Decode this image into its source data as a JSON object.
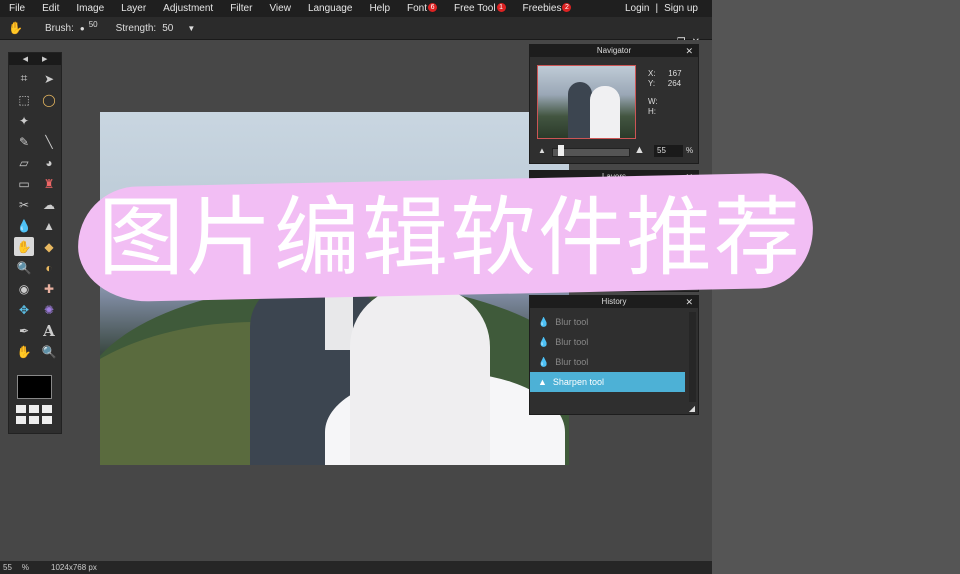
{
  "menu": {
    "items": [
      "File",
      "Edit",
      "Image",
      "Layer",
      "Adjustment",
      "Filter",
      "View",
      "Language",
      "Help"
    ],
    "font": {
      "label": "Font",
      "badge": "6"
    },
    "free_tool": {
      "label": "Free Tool",
      "badge": "1"
    },
    "freebies": {
      "label": "Freebies",
      "badge": "2"
    },
    "login": "Login",
    "separator": "|",
    "signup": "Sign up"
  },
  "toolbar": {
    "brush_label": "Brush:",
    "brush_size": "50",
    "strength_label": "Strength:",
    "strength_value": "50"
  },
  "window_controls": [
    "chevron-down",
    "restore",
    "close"
  ],
  "navigator": {
    "title": "Navigator",
    "x_label": "X:",
    "x_value": "167",
    "y_label": "Y:",
    "y_value": "264",
    "w_label": "W:",
    "h_label": "H:",
    "zoom_value": "55",
    "zoom_unit": "%"
  },
  "layers": {
    "title": "Layers"
  },
  "history": {
    "title": "History",
    "items": [
      "Blur tool",
      "Blur tool",
      "Blur tool",
      "Sharpen tool"
    ],
    "selected_index": 3
  },
  "status": {
    "zoom": "55",
    "unit": "%",
    "dimensions": "1024x768 px"
  },
  "overlay_text": "图片编辑软件推荐",
  "colors": {
    "foreground": "#000000",
    "accent": "#4db1d6",
    "overlay": "#f2bef4"
  }
}
